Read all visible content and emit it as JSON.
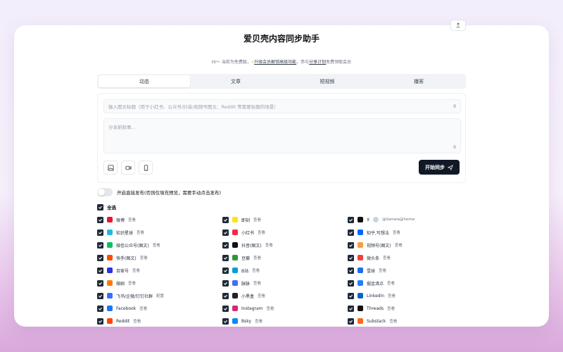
{
  "app": {
    "title": "爱贝壳内容同步助手",
    "subtitle_pre": "Hi～ 当前为免费版，",
    "subtitle_link1": "升级会员解锁高级功能",
    "subtitle_mid": "，参与",
    "subtitle_link2": "分享计划",
    "subtitle_post": "免费领取会员"
  },
  "tabs": [
    {
      "label": "动态",
      "active": true
    },
    {
      "label": "文章",
      "active": false
    },
    {
      "label": "短视频",
      "active": false
    },
    {
      "label": "播客",
      "active": false
    }
  ],
  "editor": {
    "title_placeholder": "输入图文标题（用于小红书、公众号/抖音/视频号图文、Reddit 等需要标题的场景）",
    "title_count": "0",
    "content_placeholder": "分享新鲜事...",
    "content_count": "0",
    "sync_label": "开始同步"
  },
  "toggle": {
    "label": "开启直接发布(否则仅填充预览，需要手动点击发布)"
  },
  "select_all": {
    "label": "全选"
  },
  "platforms": [
    {
      "name": "微博",
      "action": "查看",
      "color": "#e6162d",
      "icon": "weibo-icon"
    },
    {
      "name": "即刻",
      "action": "查看",
      "color": "#ffe411",
      "icon": "jike-icon"
    },
    {
      "name": "X",
      "action": "@Geneia@home",
      "color": "#111111",
      "icon": "x-icon",
      "avatar": true
    },
    {
      "name": "知识星球",
      "action": "查看",
      "color": "#23b7e5",
      "icon": "zsxq-icon"
    },
    {
      "name": "小红书",
      "action": "查看",
      "color": "#ff2442",
      "icon": "xiaohongshu-icon"
    },
    {
      "name": "知乎,写想法",
      "action": "查看",
      "color": "#0066ff",
      "icon": "zhihu-icon"
    },
    {
      "name": "微信公众号(图文)",
      "action": "查看",
      "color": "#07c160",
      "icon": "wechat-icon"
    },
    {
      "name": "抖音(图文)",
      "action": "查看",
      "color": "#111111",
      "icon": "douyin-icon"
    },
    {
      "name": "视频号(图文)",
      "action": "查看",
      "color": "#fa9d3b",
      "icon": "channels-icon"
    },
    {
      "name": "快手(图文)",
      "action": "查看",
      "color": "#ff4906",
      "icon": "kuaishou-icon"
    },
    {
      "name": "豆瓣",
      "action": "查看",
      "color": "#2e963d",
      "icon": "douban-icon"
    },
    {
      "name": "微头条",
      "action": "查看",
      "color": "#f04142",
      "icon": "toutiao-icon"
    },
    {
      "name": "百家号",
      "action": "查看",
      "color": "#2932e1",
      "icon": "baijiahao-icon"
    },
    {
      "name": "B站",
      "action": "查看",
      "color": "#00a1d6",
      "icon": "bilibili-icon"
    },
    {
      "name": "雪球",
      "action": "查看",
      "color": "#1c6ff2",
      "icon": "xueqiu-icon"
    },
    {
      "name": "微剧",
      "action": "查看",
      "color": "#ff7a00",
      "icon": "weiju-icon"
    },
    {
      "name": "脉脉",
      "action": "查看",
      "color": "#3f6ffb",
      "icon": "maimai-icon"
    },
    {
      "name": "掘金沸点",
      "action": "查看",
      "color": "#1e80ff",
      "icon": "juejin-icon"
    },
    {
      "name": "飞书/企微/钉钉社群",
      "action": "配置",
      "color": "#3370ff",
      "icon": "feishu-icon"
    },
    {
      "name": "小黑盒",
      "action": "查看",
      "color": "#222222",
      "icon": "xiaoheihe-icon"
    },
    {
      "name": "Linkedin",
      "action": "查看",
      "color": "#0a66c2",
      "icon": "linkedin-icon"
    },
    {
      "name": "Facebook",
      "action": "查看",
      "color": "#1877f2",
      "icon": "facebook-icon"
    },
    {
      "name": "Instagram",
      "action": "查看",
      "color": "#d62976",
      "icon": "instagram-icon"
    },
    {
      "name": "Threads",
      "action": "查看",
      "color": "#111111",
      "icon": "threads-icon"
    },
    {
      "name": "Reddit",
      "action": "查看",
      "color": "#ff4500",
      "icon": "reddit-icon"
    },
    {
      "name": "Bsky",
      "action": "查看",
      "color": "#1185fe",
      "icon": "bluesky-icon"
    },
    {
      "name": "Substack",
      "action": "查看",
      "color": "#ff6719",
      "icon": "substack-icon"
    }
  ]
}
